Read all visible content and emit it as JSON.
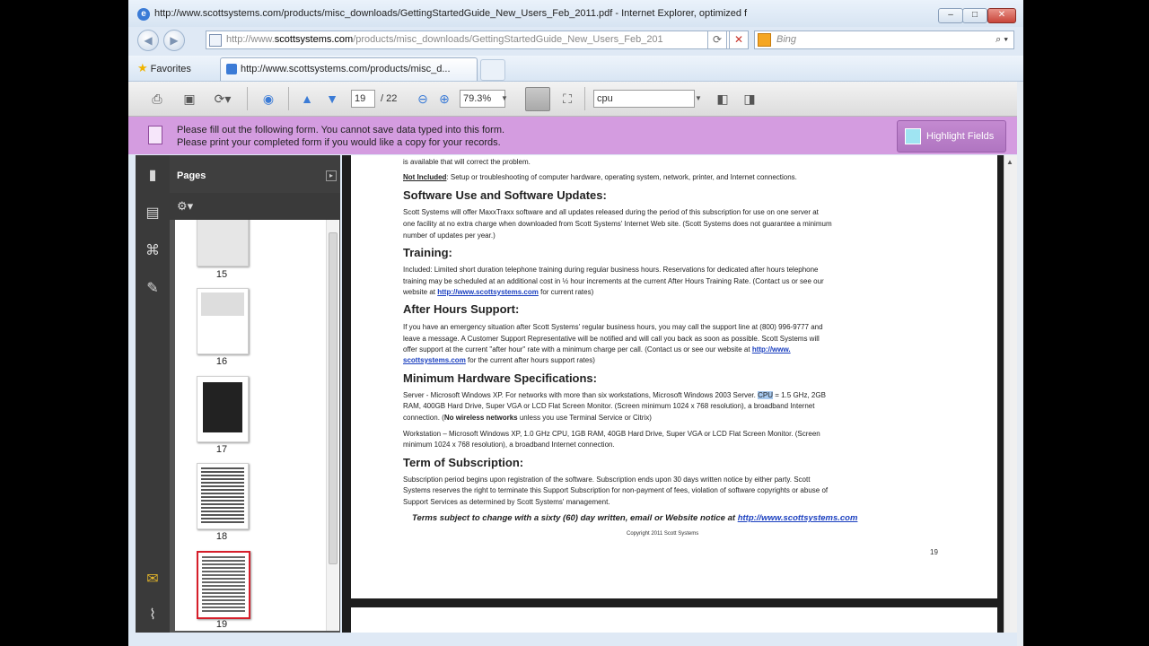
{
  "window": {
    "title": "http://www.scottsystems.com/products/misc_downloads/GettingStartedGuide_New_Users_Feb_2011.pdf - Internet Explorer, optimized f",
    "controls": {
      "minimize": "–",
      "maximize": "□",
      "close": "✕"
    }
  },
  "address": {
    "prefix": "http://www.",
    "domain": "scottsystems.com",
    "path": "/products/misc_downloads/GettingStartedGuide_New_Users_Feb_201",
    "search_placeholder": "Bing"
  },
  "favorites": {
    "label": "Favorites",
    "tab_title": "http://www.scottsystems.com/products/misc_d..."
  },
  "reader_toolbar": {
    "page_current": "19",
    "page_total": "/ 22",
    "zoom": "79.3%",
    "find_value": "cpu"
  },
  "form_notice": {
    "line1": "Please fill out the following form. You cannot save data typed into this form.",
    "line2": "Please print your completed form if you would like a copy for your records.",
    "highlight_button": "Highlight Fields"
  },
  "pages_panel": {
    "title": "Pages",
    "thumbnails": [
      "15",
      "16",
      "17",
      "18",
      "19"
    ]
  },
  "document": {
    "top_line": "is available that will correct the problem.",
    "not_included_label": "Not Included",
    "not_included_text": ":  Setup or troubleshooting of computer hardware, operating system, network, printer, and Internet connections.",
    "sections": {
      "software": {
        "heading": "Software Use and Software Updates:",
        "lines": [
          "Scott Systems will offer MaxxTraxx software and all updates released during the period of this subscription for use on one server at",
          "one facility at no extra charge when downloaded from Scott Systems' Internet Web site.  (Scott Systems does not guarantee a minimum",
          "number of updates per year.)"
        ]
      },
      "training": {
        "heading": "Training:",
        "line1": "Included:  Limited short duration telephone training during regular business hours.  Reservations for dedicated after hours telephone",
        "line2": "training may be scheduled at an additional cost in ½ hour increments at the current After Hours Training Rate.  (Contact us or see our",
        "line3_pre": "website at ",
        "line3_link": "http://www.scottsystems.com",
        "line3_post": " for current rates)"
      },
      "after_hours": {
        "heading": "After Hours Support:",
        "line1": "If you have an emergency situation after Scott Systems' regular business hours, you may call the support line at (800) 996-9777 and",
        "line2": "leave a message.  A Customer Support Representative will be notified and will call you back as soon as possible.  Scott Systems will",
        "line3_pre": "offer support at the current \"after hour\" rate with a minimum charge per call. (Contact us or see our website at ",
        "line3_link": "http://www.",
        "line4_link": "scottsystems.com",
        "line4_post": " for the current after hours support rates)"
      },
      "hardware": {
        "heading": "Minimum Hardware Specifications:",
        "server_pre": "Server - Microsoft Windows XP. For networks with more than six workstations, Microsoft Windows 2003 Server.  ",
        "server_cpu": "CPU",
        "server_post": " = 1.5 GHz, 2GB",
        "server_line2": "RAM, 400GB Hard Drive, Super VGA or LCD Flat Screen Monitor.  (Screen minimum 1024 x 768 resolution), a broadband Internet",
        "server_line3_pre": "connection.  (",
        "server_line3_bold": "No wireless networks",
        "server_line3_post": " unless you use Terminal Service or Citrix)",
        "ws_line1": "Workstation – Microsoft Windows XP, 1.0 GHz CPU, 1GB RAM, 40GB Hard Drive, Super VGA or LCD Flat Screen Monitor.  (Screen",
        "ws_line2": "minimum 1024 x 768 resolution), a broadband Internet connection."
      },
      "term": {
        "heading": "Term of Subscription:",
        "lines": [
          "Subscription period begins upon registration of the software.  Subscription ends upon 30 days written notice by either party.  Scott",
          "Systems reserves the right to terminate this Support Subscription for non-payment of fees, violation of software copyrights or abuse of",
          "Support Services as determined by Scott Systems' management."
        ]
      }
    },
    "terms_notice": "Terms subject to change with a sixty (60) day written, email or Website notice at ",
    "terms_link": "http://www.scottsystems.com",
    "copyright": "Copyright 2011 Scott Systems",
    "page_number": "19"
  }
}
